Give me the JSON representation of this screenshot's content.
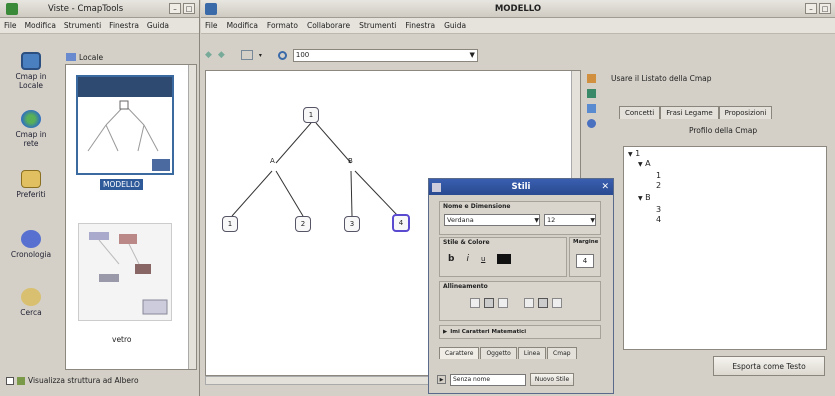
{
  "left_window": {
    "title": "Viste - CmapTools",
    "menu": [
      "File",
      "Modifica",
      "Strumenti",
      "Finestra",
      "Guida"
    ],
    "sidebar": [
      {
        "label": "Cmap in Locale",
        "icon": "computer-icon"
      },
      {
        "label": "Cmap in rete",
        "icon": "globe-icon"
      },
      {
        "label": "Preferiti",
        "icon": "favorites-icon"
      },
      {
        "label": "Cronologia",
        "icon": "history-icon"
      },
      {
        "label": "Cerca",
        "icon": "search-icon"
      }
    ],
    "location_label": "Locale",
    "thumbnails": [
      {
        "label": "MODELLO",
        "selected": true
      },
      {
        "label": "vetro",
        "selected": false
      }
    ],
    "tree_view_label": "Visualizza struttura ad Albero"
  },
  "main_window": {
    "title": "MODELLO",
    "menu": [
      "File",
      "Modifica",
      "Formato",
      "Collaborare",
      "Strumenti",
      "Finestra",
      "Guida"
    ],
    "zoom": "100",
    "concept_map": {
      "nodes": [
        "1",
        "A",
        "B",
        "1",
        "2",
        "3",
        "4"
      ]
    }
  },
  "styles_dialog": {
    "title": "Stili",
    "font_group": "Nome e Dimensione",
    "font_name": "Verdana",
    "font_size": "12",
    "style_group": "Stile & Colore",
    "margin_label": "Margine",
    "margin_value": "4",
    "bold": "b",
    "italic": "i",
    "underline": "u",
    "align_group": "Allineamento",
    "extra_label": "Imi Caratteri Matematici",
    "tabs": [
      "Carattere",
      "Oggetto",
      "Linea",
      "Cmap"
    ],
    "new_style_input": "Senza nome",
    "new_style_button": "Nuovo Stile"
  },
  "right_panel": {
    "title": "Usare il Listato della Cmap",
    "tabs": [
      "Concetti",
      "Frasi Legame",
      "Proposizioni"
    ],
    "profile_label": "Profilo della Cmap",
    "tree": [
      "1",
      "A",
      "1",
      "2",
      "B",
      "3",
      "4"
    ],
    "export_button": "Esporta come Testo"
  }
}
